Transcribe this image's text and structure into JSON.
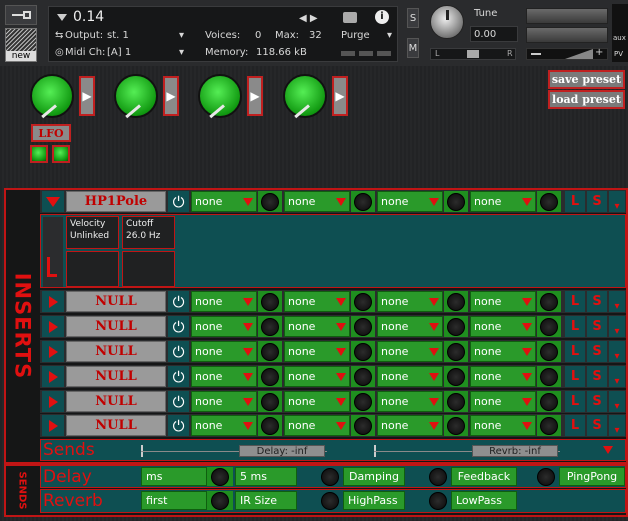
{
  "header": {
    "instrument_name": "0.14",
    "new_label": "new",
    "output_label": "Output:",
    "output_value": "st. 1",
    "voices_label": "Voices:",
    "voices_value": "0",
    "max_label": "Max:",
    "max_value": "32",
    "purge_label": "Purge",
    "midi_label": "Midi Ch:",
    "midi_value": "[A]  1",
    "memory_label": "Memory:",
    "memory_value": "118.66 kB",
    "solo_label": "S",
    "mute_label": "M",
    "tune_label": "Tune",
    "tune_value": "0.00",
    "pan_left": "L",
    "pan_right": "R",
    "aux_label": "aux",
    "pv_label": "PV"
  },
  "top": {
    "save_preset": "save preset",
    "load_preset": "load preset",
    "lfo_label": "LFO"
  },
  "inserts": {
    "side_label": "INSERTS",
    "slots": [
      {
        "name": "HP1Pole",
        "sel": [
          "none",
          "none",
          "none",
          "none"
        ]
      },
      {
        "name": "NULL",
        "sel": [
          "none",
          "none",
          "none",
          "none"
        ]
      },
      {
        "name": "NULL",
        "sel": [
          "none",
          "none",
          "none",
          "none"
        ]
      },
      {
        "name": "NULL",
        "sel": [
          "none",
          "none",
          "none",
          "none"
        ]
      },
      {
        "name": "NULL",
        "sel": [
          "none",
          "none",
          "none",
          "none"
        ]
      },
      {
        "name": "NULL",
        "sel": [
          "none",
          "none",
          "none",
          "none"
        ]
      },
      {
        "name": "NULL",
        "sel": [
          "none",
          "none",
          "none",
          "none"
        ]
      }
    ],
    "l_label": "L",
    "s_label": "S",
    "params": [
      {
        "line1": "Velocity",
        "line2": "Unlinked"
      },
      {
        "line1": "Cutoff",
        "line2": "26.0 Hz"
      }
    ]
  },
  "sends": {
    "side_label": "SENDS",
    "sends_label": "Sends",
    "delay_send": "Delay: -inf",
    "reverb_send": "Revrb: -inf",
    "delay_label": "Delay",
    "reverb_label": "Reverb",
    "delay_unit": "ms",
    "delay_time": "5 ms",
    "damping": "Damping",
    "feedback": "Feedback",
    "pingpong": "PingPong",
    "reverb_mode": "first",
    "ir_size": "IR Size",
    "highpass": "HighPass",
    "lowpass": "LowPass"
  }
}
